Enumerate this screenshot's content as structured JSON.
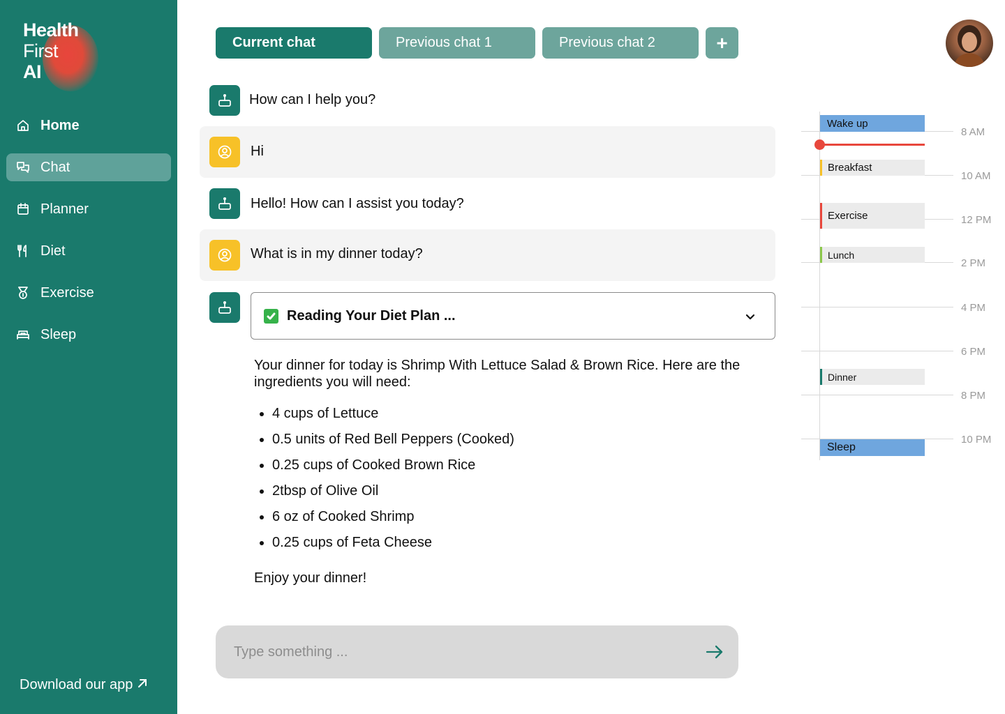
{
  "logo": {
    "line1": "Health",
    "line2": "First",
    "line3": "AI"
  },
  "sidebar": {
    "items": [
      {
        "label": "Home",
        "icon": "home-icon"
      },
      {
        "label": "Chat",
        "icon": "chat-icon",
        "active": true
      },
      {
        "label": "Planner",
        "icon": "calendar-icon"
      },
      {
        "label": "Diet",
        "icon": "utensils-icon"
      },
      {
        "label": "Exercise",
        "icon": "medal-icon"
      },
      {
        "label": "Sleep",
        "icon": "bed-icon"
      }
    ],
    "download_label": "Download our app"
  },
  "tabs": [
    {
      "label": "Current chat",
      "active": true
    },
    {
      "label": "Previous chat 1"
    },
    {
      "label": "Previous chat 2"
    },
    {
      "label": "+"
    }
  ],
  "messages": [
    {
      "role": "bot",
      "text": "How can I help you?"
    },
    {
      "role": "user",
      "text": "Hi"
    },
    {
      "role": "bot",
      "text": "Hello! How can I assist you today?"
    },
    {
      "role": "user",
      "text": "What is in my dinner today?"
    }
  ],
  "response": {
    "status_label": "Reading Your Diet Plan ...",
    "intro": "Your dinner for today is Shrimp With Lettuce Salad & Brown Rice. Here are the ingredients you will need:",
    "ingredients": [
      "4 cups of Lettuce",
      "0.5 units of Red Bell Peppers (Cooked)",
      "0.25 cups of Cooked Brown Rice",
      "2tbsp of Olive Oil",
      "6 oz of Cooked Shrimp",
      "0.25  cups of Feta Cheese"
    ],
    "closing": "Enjoy your dinner!"
  },
  "input": {
    "placeholder": "Type something ..."
  },
  "timeline": {
    "hours": [
      "8 AM",
      "10 AM",
      "12 PM",
      "2 PM",
      "4 PM",
      "6 PM",
      "8 PM",
      "10 PM"
    ],
    "events": [
      {
        "label": "Wake up",
        "color": "#6fa6de"
      },
      {
        "label": "Breakfast",
        "color": "#f7c128"
      },
      {
        "label": "Exercise",
        "color": "#e8473c"
      },
      {
        "label": "Lunch",
        "color": "#8cc84b"
      },
      {
        "label": "Dinner",
        "color": "#1a7a6c"
      },
      {
        "label": "Sleep",
        "color": "#6fa6de"
      }
    ],
    "now_color": "#e8473c"
  },
  "colors": {
    "primary": "#1a7a6c",
    "tab_inactive": "#6da59c",
    "user_icon": "#f7c128"
  }
}
